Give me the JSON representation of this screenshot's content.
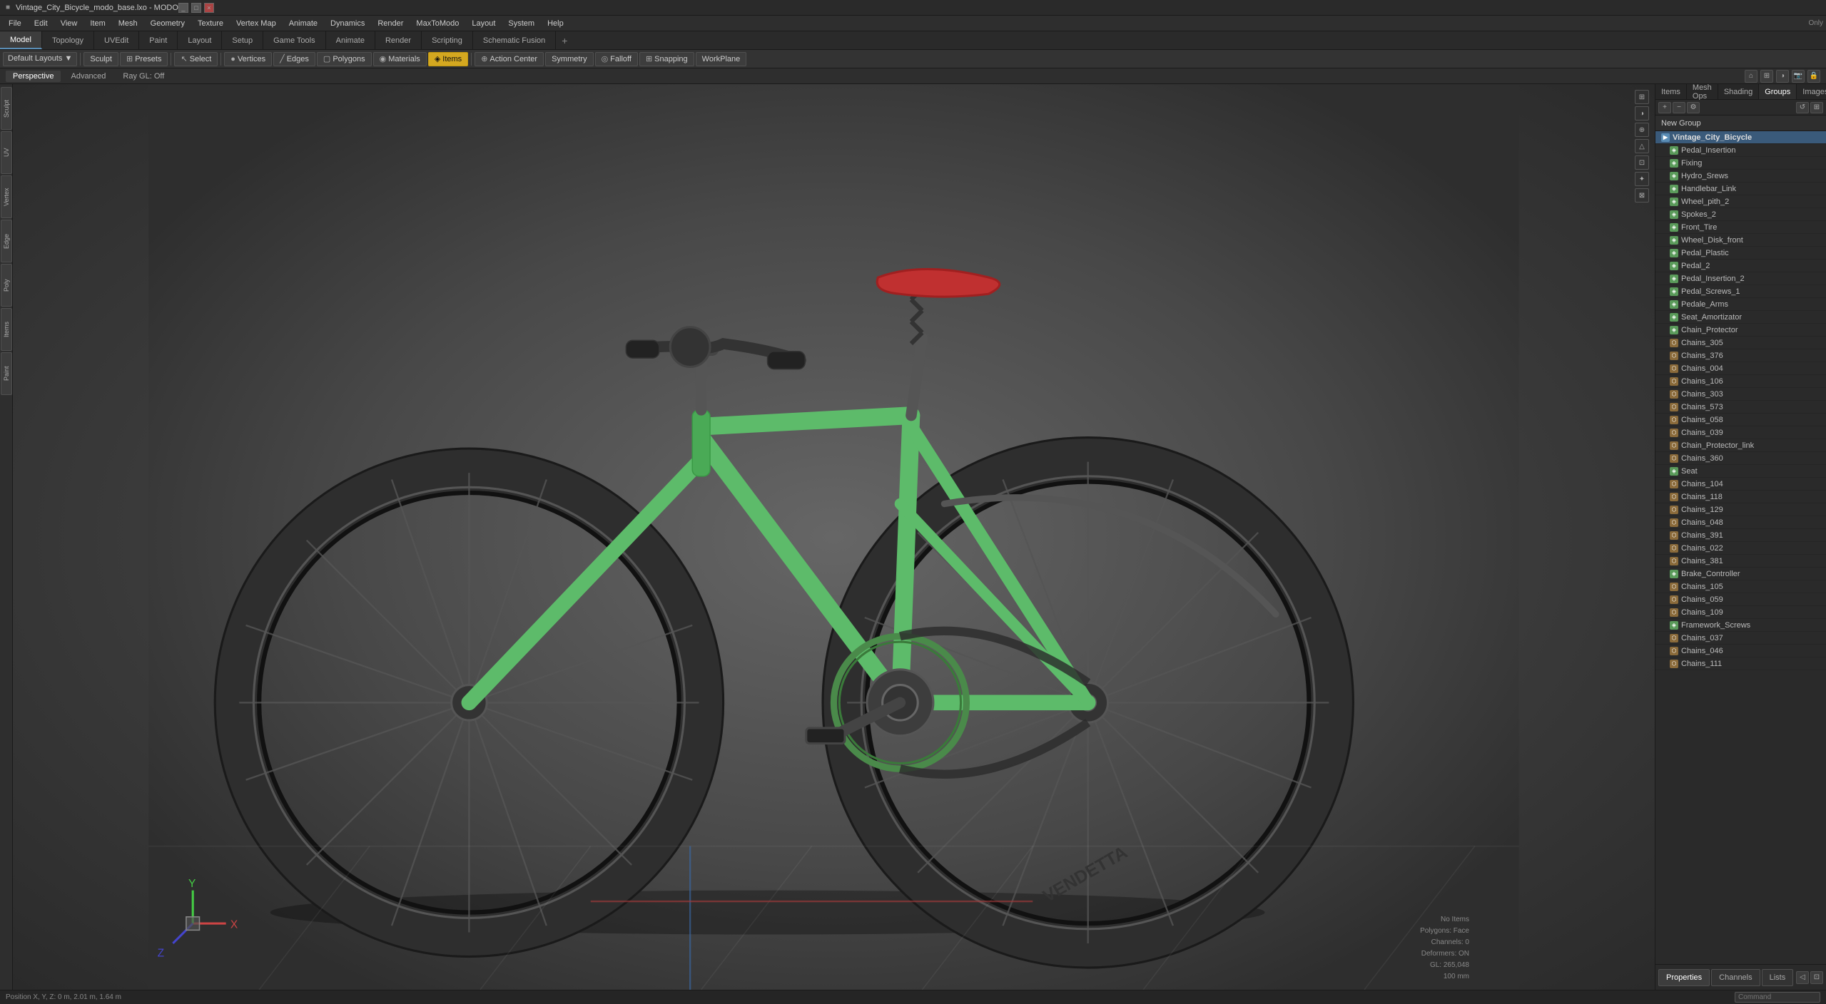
{
  "window": {
    "title": "Vintage_City_Bicycle_modo_base.lxo - MODO",
    "controls": [
      "_",
      "□",
      "×"
    ]
  },
  "menu": {
    "items": [
      "File",
      "Edit",
      "View",
      "Item",
      "Mesh",
      "Geometry",
      "Texture",
      "Vertex Map",
      "Animate",
      "Dynamics",
      "Render",
      "MaxToModo",
      "Layout",
      "System",
      "Help"
    ]
  },
  "main_tabs": {
    "tabs": [
      "Model",
      "Topology",
      "UVEdit",
      "Paint",
      "Layout",
      "Setup",
      "Game Tools",
      "Animate",
      "Render",
      "Scripting",
      "Schematic Fusion"
    ],
    "active": "Model",
    "add_label": "+"
  },
  "toolbar": {
    "layout_label": "Default Layouts",
    "sculpt_label": "Sculpt",
    "presets_label": "Presets",
    "select_label": "Select",
    "vertices_label": "Vertices",
    "edges_label": "Edges",
    "polygons_label": "Polygons",
    "materials_label": "Materials",
    "items_label": "Items",
    "action_center_label": "Action Center",
    "symmetry_label": "Symmetry",
    "falloff_label": "Falloff",
    "snapping_label": "Snapping",
    "workplane_label": "WorkPlane",
    "only_label": "Only"
  },
  "viewport": {
    "tabs": [
      "Perspective",
      "Advanced",
      "Ray GL: Off"
    ],
    "active_tab": "Perspective"
  },
  "right_panel": {
    "tabs": [
      "Items",
      "Mesh Ops",
      "Shading",
      "Groups",
      "Images"
    ],
    "active_tab": "Groups",
    "new_group_label": "New Group",
    "scene_root": "Vintage_City_Bicycle",
    "scene_items": [
      {
        "name": "Vintage_City_Bicycle",
        "type": "group",
        "level": 0
      },
      {
        "name": "Pedal_Insertion",
        "type": "mesh",
        "level": 1
      },
      {
        "name": "Fixing",
        "type": "mesh",
        "level": 1
      },
      {
        "name": "Hydro_Srews",
        "type": "mesh",
        "level": 1
      },
      {
        "name": "Handlebar_Link",
        "type": "mesh",
        "level": 1
      },
      {
        "name": "Wheel_pith_2",
        "type": "mesh",
        "level": 1
      },
      {
        "name": "Spokes_2",
        "type": "mesh",
        "level": 1
      },
      {
        "name": "Front_Tire",
        "type": "mesh",
        "level": 1
      },
      {
        "name": "Wheel_Disk_front",
        "type": "mesh",
        "level": 1
      },
      {
        "name": "Pedal_Plastic",
        "type": "mesh",
        "level": 1
      },
      {
        "name": "Pedal_2",
        "type": "mesh",
        "level": 1
      },
      {
        "name": "Pedal_Insertion_2",
        "type": "mesh",
        "level": 1
      },
      {
        "name": "Pedal_Screws_1",
        "type": "mesh",
        "level": 1
      },
      {
        "name": "Pedale_Arms",
        "type": "mesh",
        "level": 1
      },
      {
        "name": "Seat_Amortizator",
        "type": "mesh",
        "level": 1
      },
      {
        "name": "Chain_Protector",
        "type": "mesh",
        "level": 1
      },
      {
        "name": "Chains_305",
        "type": "chain",
        "level": 1
      },
      {
        "name": "Chains_376",
        "type": "chain",
        "level": 1
      },
      {
        "name": "Chains_004",
        "type": "chain",
        "level": 1
      },
      {
        "name": "Chains_106",
        "type": "chain",
        "level": 1
      },
      {
        "name": "Chains_303",
        "type": "chain",
        "level": 1
      },
      {
        "name": "Chains_573",
        "type": "chain",
        "level": 1
      },
      {
        "name": "Chains_058",
        "type": "chain",
        "level": 1
      },
      {
        "name": "Chains_039",
        "type": "chain",
        "level": 1
      },
      {
        "name": "Chain_Protector_link",
        "type": "chain",
        "level": 1
      },
      {
        "name": "Chains_360",
        "type": "chain",
        "level": 1
      },
      {
        "name": "Seat",
        "type": "mesh",
        "level": 1
      },
      {
        "name": "Chains_104",
        "type": "chain",
        "level": 1
      },
      {
        "name": "Chains_118",
        "type": "chain",
        "level": 1
      },
      {
        "name": "Chains_129",
        "type": "chain",
        "level": 1
      },
      {
        "name": "Chains_048",
        "type": "chain",
        "level": 1
      },
      {
        "name": "Chains_391",
        "type": "chain",
        "level": 1
      },
      {
        "name": "Chains_022",
        "type": "chain",
        "level": 1
      },
      {
        "name": "Chains_381",
        "type": "chain",
        "level": 1
      },
      {
        "name": "Brake_Controller",
        "type": "mesh",
        "level": 1
      },
      {
        "name": "Chains_105",
        "type": "chain",
        "level": 1
      },
      {
        "name": "Chains_059",
        "type": "chain",
        "level": 1
      },
      {
        "name": "Chains_109",
        "type": "chain",
        "level": 1
      },
      {
        "name": "Framework_Screws",
        "type": "mesh",
        "level": 1
      },
      {
        "name": "Chains_037",
        "type": "chain",
        "level": 1
      },
      {
        "name": "Chains_046",
        "type": "chain",
        "level": 1
      },
      {
        "name": "Chains_111",
        "type": "chain",
        "level": 1
      }
    ]
  },
  "bottom_panel": {
    "tabs": [
      "Properties",
      "Channels",
      "Lists"
    ],
    "active_tab": "Properties"
  },
  "status_bar": {
    "position": "Position X, Y, Z:  0 m, 2.01 m, 1.64 m"
  },
  "viewport_info": {
    "line1": "No Items",
    "line2": "Polygons: Face",
    "line3": "Channels: 0",
    "line4": "Deformers: ON",
    "line5": "GL: 265,048",
    "line6": "100 mm"
  },
  "icons": {
    "mesh": "◈",
    "chain": "⬡",
    "group": "▶",
    "arrow_down": "▼",
    "camera": "📷",
    "light": "💡",
    "expand": "+",
    "collapse": "-",
    "lock": "🔒",
    "visible": "👁",
    "plus": "+",
    "minus": "-",
    "gear": "⚙",
    "folder": "📁"
  },
  "colors": {
    "accent": "#5a8db5",
    "active_tab_bg": "#3d3d3d",
    "toolbar_active": "#d4a820",
    "mesh_icon": "#5daa5d",
    "chain_icon": "#c8a040",
    "group_icon": "#5a8db5",
    "background": "#3a3a3a",
    "panel_bg": "#2e2e2e",
    "border": "#1a1a1a"
  }
}
